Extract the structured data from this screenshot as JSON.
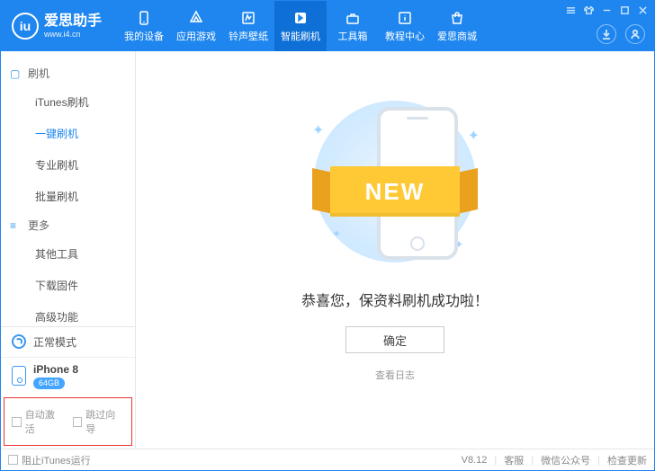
{
  "brand": {
    "logo": "iu",
    "title": "爱思助手",
    "site": "www.i4.cn"
  },
  "tabs": [
    {
      "id": "devices",
      "label": "我的设备"
    },
    {
      "id": "games",
      "label": "应用游戏"
    },
    {
      "id": "ringtones",
      "label": "铃声壁纸"
    },
    {
      "id": "flash",
      "label": "智能刷机",
      "active": true
    },
    {
      "id": "toolbox",
      "label": "工具箱"
    },
    {
      "id": "tutorial",
      "label": "教程中心"
    },
    {
      "id": "mall",
      "label": "爱思商城"
    }
  ],
  "sidebar": {
    "sections": [
      {
        "title": "刷机",
        "items": [
          {
            "id": "itunes-flash",
            "label": "iTunes刷机"
          },
          {
            "id": "oneclick-flash",
            "label": "一键刷机",
            "active": true
          },
          {
            "id": "pro-flash",
            "label": "专业刷机"
          },
          {
            "id": "batch-flash",
            "label": "批量刷机"
          }
        ]
      },
      {
        "title": "更多",
        "items": [
          {
            "id": "other-tools",
            "label": "其他工具"
          },
          {
            "id": "download-fw",
            "label": "下载固件"
          },
          {
            "id": "advanced",
            "label": "高级功能"
          }
        ]
      }
    ],
    "mode": "正常模式",
    "device": {
      "name": "iPhone 8",
      "storage": "64GB"
    },
    "options": {
      "auto_activate": "自动激活",
      "skip_setup": "跳过向导"
    }
  },
  "main": {
    "ribbon": "NEW",
    "message": "恭喜您，保资料刷机成功啦！",
    "confirm": "确定",
    "view_log": "查看日志"
  },
  "footer": {
    "block_itunes": "阻止iTunes运行",
    "version": "V8.12",
    "support": "客服",
    "wechat": "微信公众号",
    "update": "检查更新"
  }
}
